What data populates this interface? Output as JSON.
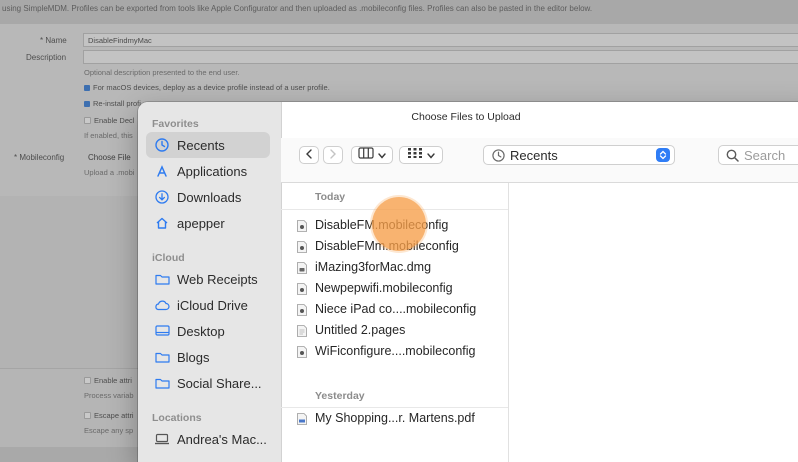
{
  "background": {
    "top_note": "using SimpleMDM. Profiles can be exported from tools like Apple Configurator and then uploaded as .mobileconfig files. Profiles can also be pasted in the editor below.",
    "name_label": "* Name",
    "name_value": "DisableFindmyMac",
    "description_label": "Description",
    "description_hint": "Optional description presented to the end user.",
    "checkbox_device_profile": "For macOS devices, deploy as a device profile instead of a user profile.",
    "checkbox_reinstall": "Re-install profi",
    "checkbox_enable_decl": "Enable Decl",
    "enable_hint": "If enabled, this",
    "mobileconfig_label": "* Mobileconfig",
    "choose_file": "Choose File",
    "upload_hint": "Upload a .mobi",
    "enable_attr": "Enable attri",
    "process_hint": "Process variab",
    "escape_attr": "Escape attri",
    "escape_hint": "Escape any sp"
  },
  "dialog": {
    "title": "Choose Files to Upload",
    "location": "Recents",
    "search_placeholder": "Search",
    "sidebar": {
      "favorites_header": "Favorites",
      "favorites": [
        {
          "label": "Recents",
          "icon": "clock-icon",
          "selected": true
        },
        {
          "label": "Applications",
          "icon": "applications-icon"
        },
        {
          "label": "Downloads",
          "icon": "download-icon"
        },
        {
          "label": "apepper",
          "icon": "home-icon"
        }
      ],
      "icloud_header": "iCloud",
      "icloud": [
        {
          "label": "Web Receipts",
          "icon": "folder-icon"
        },
        {
          "label": "iCloud Drive",
          "icon": "cloud-icon"
        },
        {
          "label": "Desktop",
          "icon": "desktop-icon"
        },
        {
          "label": "Blogs",
          "icon": "folder-icon"
        },
        {
          "label": "Social Share...",
          "icon": "folder-icon"
        }
      ],
      "locations_header": "Locations",
      "locations": [
        {
          "label": "Andrea's Mac...",
          "icon": "laptop-icon"
        }
      ]
    },
    "groups": [
      {
        "header": "Today",
        "files": [
          "DisableFM.mobileconfig",
          "DisableFMm.mobileconfig",
          "iMazing3forMac.dmg",
          "Newpepwifi.mobileconfig",
          "Niece iPad co....mobileconfig",
          "Untitled 2.pages",
          "WiFiconfigure....mobileconfig"
        ]
      },
      {
        "header": "Yesterday",
        "files": [
          "My Shopping...r. Martens.pdf"
        ]
      }
    ],
    "accent_color": "#2f7df6",
    "sidebar_icon_color": "#2e7bf0"
  }
}
